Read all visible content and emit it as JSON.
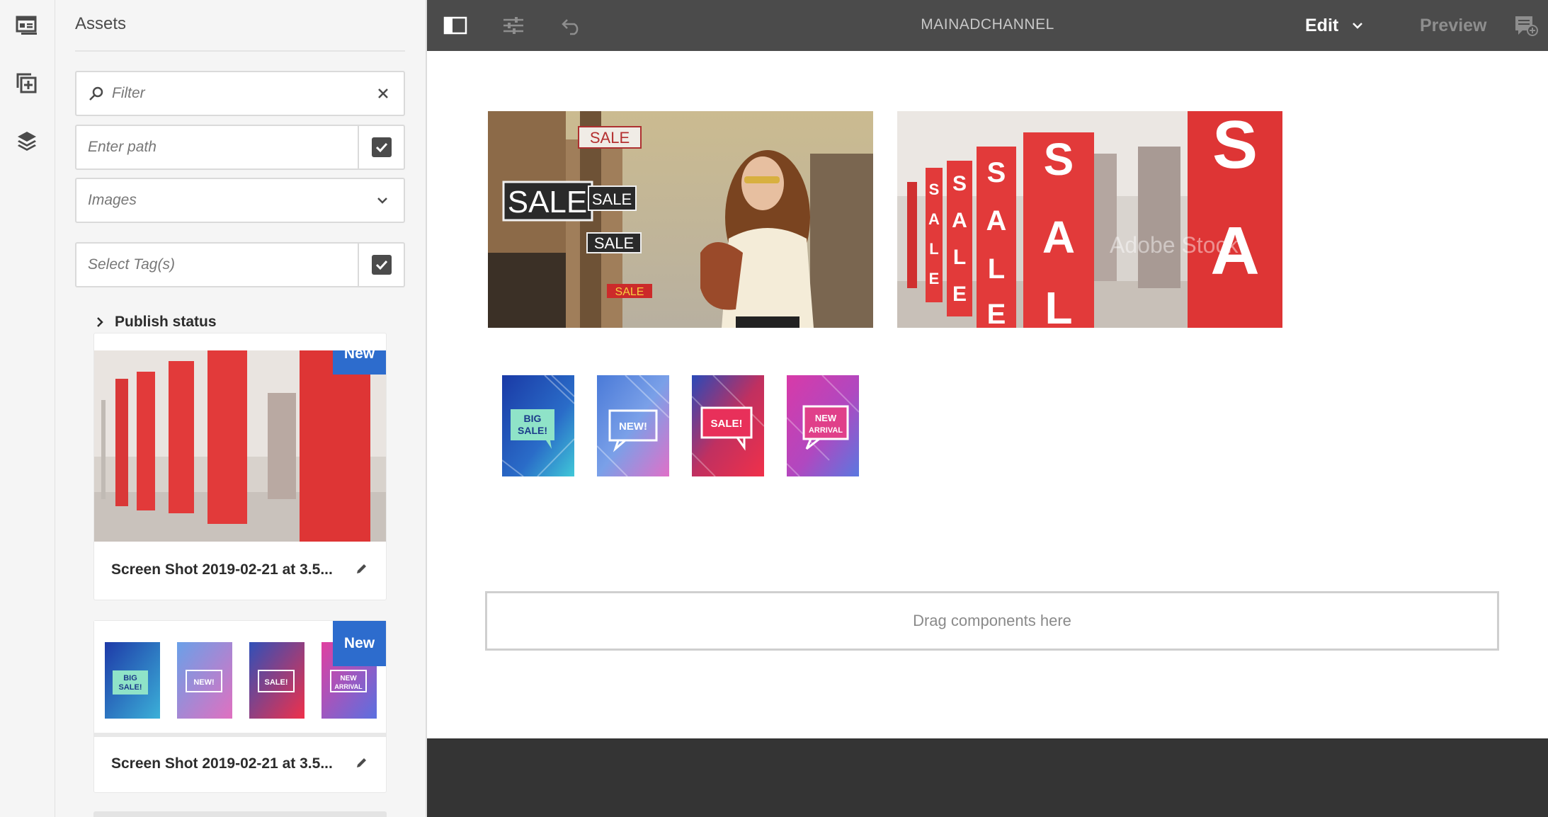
{
  "rail": {
    "items": [
      {
        "icon": "asset-browser-icon"
      },
      {
        "icon": "add-component-icon"
      },
      {
        "icon": "layers-icon"
      }
    ]
  },
  "panel": {
    "title": "Assets",
    "filter": {
      "placeholder": "Filter"
    },
    "path": {
      "placeholder": "Enter path"
    },
    "type_select": {
      "value": "Images"
    },
    "tags": {
      "placeholder": "Select Tag(s)"
    },
    "publish_status": "Publish status",
    "cards": [
      {
        "name": "Screen Shot 2019-02-21 at 3.5...",
        "badge": "New"
      },
      {
        "name": "Screen Shot 2019-02-21 at 3.5...",
        "badge": "New"
      }
    ]
  },
  "topbar": {
    "title": "MAINADCHANNEL",
    "mode_edit": "Edit",
    "mode_preview": "Preview"
  },
  "canvas": {
    "dropzone": "Drag components here",
    "photo1_signs": [
      "SALE",
      "SALE",
      "SALE",
      "SALE",
      "SALE"
    ],
    "photo2_letters": [
      "S",
      "A",
      "L",
      "E"
    ],
    "tiles": [
      {
        "lines": [
          "BIG",
          "SALE!"
        ],
        "text_color": "#1b3a8a",
        "bubble": "#8fe3c8"
      },
      {
        "lines": [
          "NEW!"
        ],
        "text_color": "#ffffff",
        "bubble": "#7aa0e8"
      },
      {
        "lines": [
          "SALE!"
        ],
        "text_color": "#ffffff",
        "bubble": "#e8305a"
      },
      {
        "lines": [
          "NEW",
          "ARRIVAL"
        ],
        "text_color": "#ffffff",
        "bubble": "#e0408a"
      }
    ],
    "watermark": "Adobe Stock"
  },
  "colors": {
    "accent": "#2d6ccd",
    "topbar": "#4b4b4b",
    "footer": "#343434",
    "sale_red": "#e23a3a"
  }
}
